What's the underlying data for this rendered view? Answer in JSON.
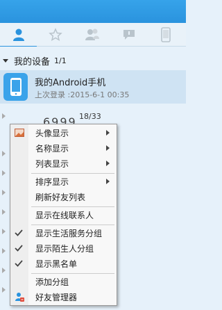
{
  "tabs": [
    {
      "name": "contacts",
      "icon": "person-icon"
    },
    {
      "name": "favorites",
      "icon": "star-icon"
    },
    {
      "name": "groups",
      "icon": "group-icon"
    },
    {
      "name": "messages",
      "icon": "chat-icon"
    },
    {
      "name": "devices",
      "icon": "phone-icon"
    }
  ],
  "group": {
    "name": "我的设备",
    "count": "1/1"
  },
  "device": {
    "name": "我的Android手机",
    "last_login": "上次登录 :2015-6-1 00:35"
  },
  "partial": {
    "text": "6999",
    "count": "18/33"
  },
  "menu": {
    "items": [
      {
        "label": "头像显示",
        "submenu": true
      },
      {
        "label": "名称显示",
        "submenu": true
      },
      {
        "label": "列表显示",
        "submenu": true
      },
      {
        "label": "排序显示",
        "submenu": true
      },
      {
        "label": "刷新好友列表"
      },
      {
        "label": "显示在线联系人"
      },
      {
        "label": "显示生活服务分组",
        "checked": true
      },
      {
        "label": "显示陌生人分组",
        "checked": true
      },
      {
        "label": "显示黑名单",
        "checked": true
      },
      {
        "label": "添加分组"
      },
      {
        "label": "好友管理器"
      }
    ]
  },
  "colors": {
    "accent": "#2a93de",
    "background": "#e6f1fa"
  }
}
